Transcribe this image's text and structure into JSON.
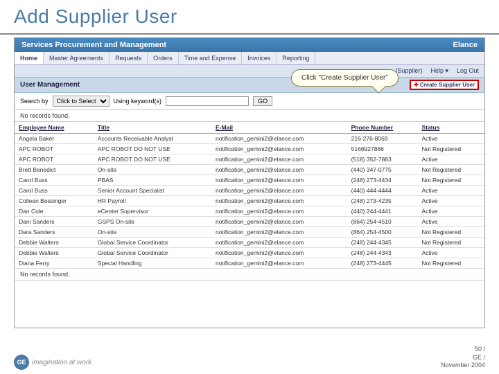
{
  "slide_title": "Add Supplier User",
  "app_title": "Services Procurement and Management",
  "brand": "Elance",
  "nav": [
    "Home",
    "Master Agreements",
    "Requests",
    "Orders",
    "Time and Expense",
    "Invoices",
    "Reporting"
  ],
  "sub_links": {
    "supplier": "(Supplier)",
    "help": "Help ▾",
    "logout": "Log Out"
  },
  "section_title": "User Management",
  "create_btn": "Create Supplier User",
  "search": {
    "label": "Search by",
    "select": "Click to Select",
    "keywords": "Using keyword(s)",
    "go": "GO"
  },
  "norec": "No records found.",
  "columns": [
    "Employee Name",
    "Title",
    "E-Mail",
    "Phone Number",
    "Status"
  ],
  "rows": [
    {
      "name": "Angela Baker",
      "title": "Accounts Receivable Analyst",
      "email": "notification_gemini2@elance.com",
      "phone": "216-276-8069",
      "status": "Active"
    },
    {
      "name": "APC ROBOT",
      "title": "APC ROBOT DO NOT USE",
      "email": "notification_gemini2@elance.com",
      "phone": "5166927866",
      "status": "Not Registered"
    },
    {
      "name": "APC ROBOT",
      "title": "APC ROBOT DO NOT USE",
      "email": "notification_gemini2@elance.com",
      "phone": "(518) 352-7883",
      "status": "Active"
    },
    {
      "name": "Brett Benedict",
      "title": "On-site",
      "email": "notification_gemini2@elance.com",
      "phone": "(440) 347-0775",
      "status": "Not Registered"
    },
    {
      "name": "Carol Buss",
      "title": "PBAS",
      "email": "notification_gemini2@elance.com",
      "phone": "(248) 273-4434",
      "status": "Not Registered"
    },
    {
      "name": "Carol Buss",
      "title": "Senior Account Specialist",
      "email": "notification_gemini2@elance.com",
      "phone": "(440) 444-4444",
      "status": "Active"
    },
    {
      "name": "Colleen Bessinger",
      "title": "HR Payroll",
      "email": "notification_gemini2@elance.com",
      "phone": "(248) 273-4235",
      "status": "Active"
    },
    {
      "name": "Dan Cole",
      "title": "eCenter Supervisor",
      "email": "notification_gemini2@elance.com",
      "phone": "(440) 244-4441",
      "status": "Active"
    },
    {
      "name": "Dani Sanders",
      "title": "GSPS On-site",
      "email": "notification_gemini2@elance.com",
      "phone": "(864) 254-4510",
      "status": "Active"
    },
    {
      "name": "Dara Sanders",
      "title": "On-site",
      "email": "notification_gemini2@elance.com",
      "phone": "(864) 254-4500",
      "status": "Not Registered"
    },
    {
      "name": "Debbie Walters",
      "title": "Global Service Coordinator",
      "email": "notification_gemini2@elance.com",
      "phone": "(248) 244-4345",
      "status": "Not Registered"
    },
    {
      "name": "Debbie Walters",
      "title": "Global Service Coordinator",
      "email": "notification_gemini2@elance.com",
      "phone": "(248) 244-4343",
      "status": "Active"
    },
    {
      "name": "Diana Ferry",
      "title": "Special Handling",
      "email": "notification_gemini2@elance.com",
      "phone": "(248) 273-4445",
      "status": "Not Registered"
    }
  ],
  "callout": "Click \"Create Supplier User\"",
  "footer": {
    "tagline": "imagination at work",
    "page": "50 /",
    "org": "GE /",
    "date": "November 2004"
  }
}
